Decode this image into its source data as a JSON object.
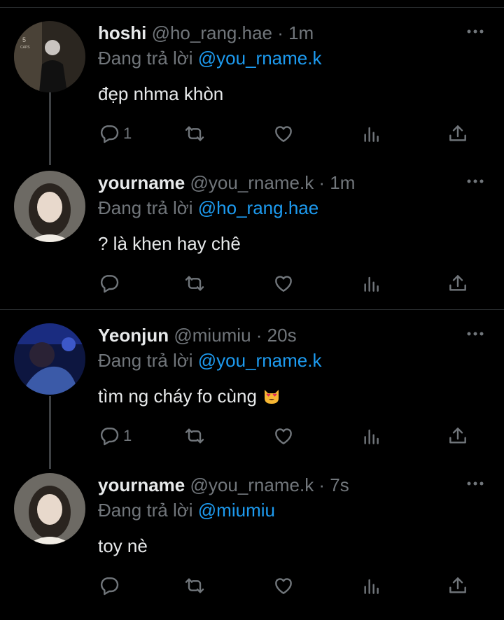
{
  "colors": {
    "background": "#000000",
    "text": "#e7e9ea",
    "muted": "#71767b",
    "link": "#1d9bf0",
    "separator": "#2f3336"
  },
  "tweets": [
    {
      "name": "hoshi",
      "meta": "@ho_rang.hae · 1m",
      "reply_prefix": "Đang trả lời ",
      "reply_handle": "@you_rname.k",
      "text": "đẹp nhma khòn",
      "reply_count": "1",
      "avatar": "avatar-hoshi"
    },
    {
      "name": "yourname",
      "meta": "@you_rname.k · 1m",
      "reply_prefix": "Đang trả lời ",
      "reply_handle": "@ho_rang.hae",
      "text": "? là khen hay chê",
      "reply_count": "",
      "avatar": "avatar-yourname"
    },
    {
      "name": "Yeonjun",
      "meta": "@miumiu · 20s",
      "reply_prefix": "Đang trả lời ",
      "reply_handle": "@you_rname.k",
      "text": "tìm ng cháy fo cùng ",
      "emoji": "heart-eyes-cat-emoji",
      "reply_count": "1",
      "avatar": "avatar-yeonjun"
    },
    {
      "name": "yourname",
      "meta": "@you_rname.k · 7s",
      "reply_prefix": "Đang trả lời ",
      "reply_handle": "@miumiu",
      "text": "toy nè",
      "reply_count": "",
      "avatar": "avatar-yourname"
    }
  ],
  "icons": [
    "reply-icon",
    "retweet-icon",
    "like-icon",
    "analytics-icon",
    "share-icon",
    "more-icon"
  ]
}
